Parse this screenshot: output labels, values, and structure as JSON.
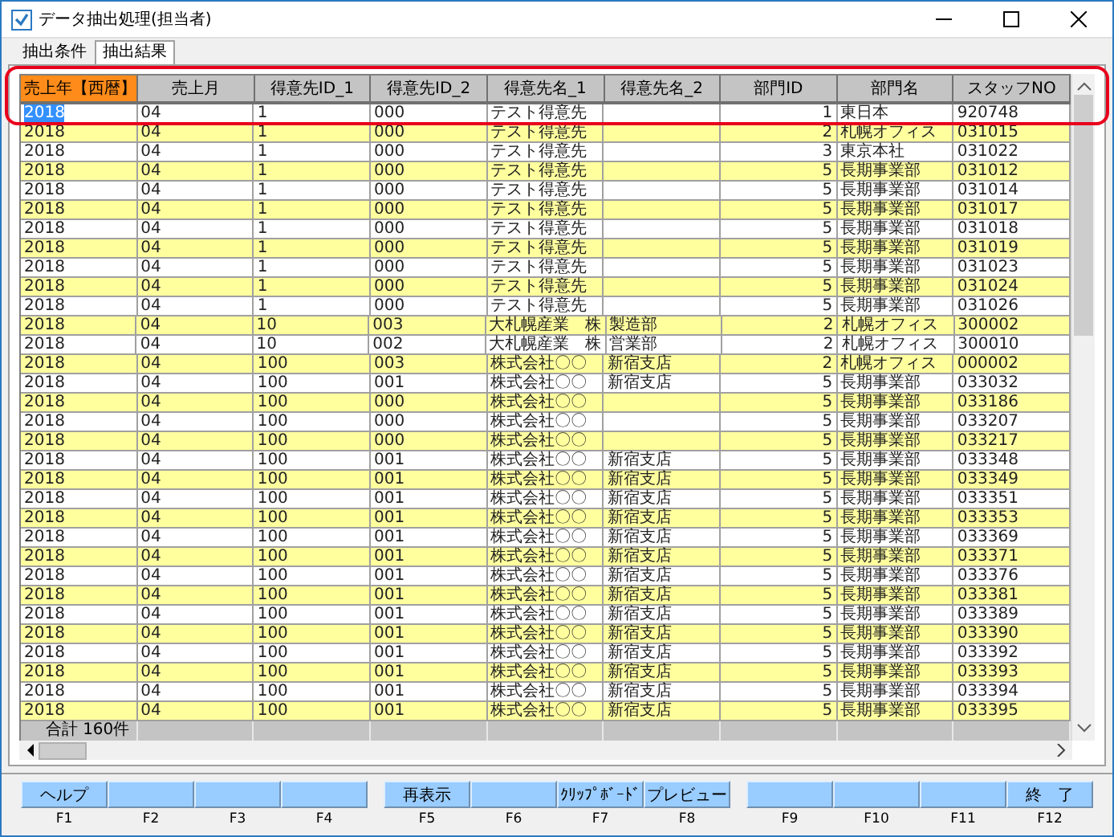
{
  "window": {
    "title": "データ抽出処理(担当者)"
  },
  "tabs": [
    {
      "label": "抽出条件",
      "selected": false
    },
    {
      "label": "抽出結果",
      "selected": true
    }
  ],
  "table": {
    "columns": [
      {
        "label": "売上年【西暦】",
        "highlighted": true
      },
      {
        "label": "売上月",
        "highlighted": false
      },
      {
        "label": "得意先ID_1",
        "highlighted": false
      },
      {
        "label": "得意先ID_2",
        "highlighted": false
      },
      {
        "label": "得意先名_1",
        "highlighted": false
      },
      {
        "label": "得意先名_2",
        "highlighted": false
      },
      {
        "label": "部門ID",
        "highlighted": false
      },
      {
        "label": "部門名",
        "highlighted": false
      },
      {
        "label": "スタッフNO",
        "highlighted": false
      }
    ],
    "rows": [
      {
        "year": "2018",
        "month": "04",
        "customer_id_1": "1",
        "customer_id_2": "000",
        "customer_name_1": "テスト得意先",
        "dept_id": "1",
        "dept_name": "東日本",
        "staff_no": "920748",
        "selected": true
      },
      {
        "year": "2018",
        "month": "04",
        "customer_id_1": "1",
        "customer_id_2": "000",
        "customer_name_1": "テスト得意先",
        "dept_id": "2",
        "dept_name": "札幌オフィス",
        "staff_no": "031015",
        "selected": false
      },
      {
        "year": "2018",
        "month": "04",
        "customer_id_1": "1",
        "customer_id_2": "000",
        "customer_name_1": "テスト得意先",
        "dept_id": "3",
        "dept_name": "東京本社",
        "staff_no": "031022",
        "selected": false
      },
      {
        "year": "2018",
        "month": "04",
        "customer_id_1": "1",
        "customer_id_2": "000",
        "customer_name_1": "テスト得意先",
        "dept_id": "5",
        "dept_name": "長期事業部",
        "staff_no": "031012",
        "selected": false
      },
      {
        "year": "2018",
        "month": "04",
        "customer_id_1": "1",
        "customer_id_2": "000",
        "customer_name_1": "テスト得意先",
        "dept_id": "5",
        "dept_name": "長期事業部",
        "staff_no": "031014",
        "selected": false
      },
      {
        "year": "2018",
        "month": "04",
        "customer_id_1": "1",
        "customer_id_2": "000",
        "customer_name_1": "テスト得意先",
        "dept_id": "5",
        "dept_name": "長期事業部",
        "staff_no": "031017",
        "selected": false
      },
      {
        "year": "2018",
        "month": "04",
        "customer_id_1": "1",
        "customer_id_2": "000",
        "customer_name_1": "テスト得意先",
        "dept_id": "5",
        "dept_name": "長期事業部",
        "staff_no": "031018",
        "selected": false
      },
      {
        "year": "2018",
        "month": "04",
        "customer_id_1": "1",
        "customer_id_2": "000",
        "customer_name_1": "テスト得意先",
        "dept_id": "5",
        "dept_name": "長期事業部",
        "staff_no": "031019",
        "selected": false
      },
      {
        "year": "2018",
        "month": "04",
        "customer_id_1": "1",
        "customer_id_2": "000",
        "customer_name_1": "テスト得意先",
        "dept_id": "5",
        "dept_name": "長期事業部",
        "staff_no": "031023",
        "selected": false
      },
      {
        "year": "2018",
        "month": "04",
        "customer_id_1": "1",
        "customer_id_2": "000",
        "customer_name_1": "テスト得意先",
        "dept_id": "5",
        "dept_name": "長期事業部",
        "staff_no": "031024",
        "selected": false
      },
      {
        "year": "2018",
        "month": "04",
        "customer_id_1": "1",
        "customer_id_2": "000",
        "customer_name_1": "テスト得意先",
        "dept_id": "5",
        "dept_name": "長期事業部",
        "staff_no": "031026",
        "selected": false
      },
      {
        "year": "2018",
        "month": "04",
        "customer_id_1": "10",
        "customer_id_2": "003",
        "customer_name_1": "大札幌産業　株",
        "customer_name_2": "製造部",
        "dept_id": "2",
        "dept_name": "札幌オフィス",
        "staff_no": "300002",
        "selected": false
      },
      {
        "year": "2018",
        "month": "04",
        "customer_id_1": "10",
        "customer_id_2": "002",
        "customer_name_1": "大札幌産業　株",
        "customer_name_2": "営業部",
        "dept_id": "2",
        "dept_name": "札幌オフィス",
        "staff_no": "300010",
        "selected": false
      },
      {
        "year": "2018",
        "month": "04",
        "customer_id_1": "100",
        "customer_id_2": "003",
        "customer_name_1": "株式会社〇〇",
        "customer_name_2": "新宿支店",
        "dept_id": "2",
        "dept_name": "札幌オフィス",
        "staff_no": "000002",
        "selected": false
      },
      {
        "year": "2018",
        "month": "04",
        "customer_id_1": "100",
        "customer_id_2": "001",
        "customer_name_1": "株式会社〇〇",
        "customer_name_2": "新宿支店",
        "dept_id": "5",
        "dept_name": "長期事業部",
        "staff_no": "033032",
        "selected": false
      },
      {
        "year": "2018",
        "month": "04",
        "customer_id_1": "100",
        "customer_id_2": "000",
        "customer_name_1": "株式会社〇〇",
        "dept_id": "5",
        "dept_name": "長期事業部",
        "staff_no": "033186",
        "selected": false
      },
      {
        "year": "2018",
        "month": "04",
        "customer_id_1": "100",
        "customer_id_2": "000",
        "customer_name_1": "株式会社〇〇",
        "dept_id": "5",
        "dept_name": "長期事業部",
        "staff_no": "033207",
        "selected": false
      },
      {
        "year": "2018",
        "month": "04",
        "customer_id_1": "100",
        "customer_id_2": "000",
        "customer_name_1": "株式会社〇〇",
        "dept_id": "5",
        "dept_name": "長期事業部",
        "staff_no": "033217",
        "selected": false
      },
      {
        "year": "2018",
        "month": "04",
        "customer_id_1": "100",
        "customer_id_2": "001",
        "customer_name_1": "株式会社〇〇",
        "customer_name_2": "新宿支店",
        "dept_id": "5",
        "dept_name": "長期事業部",
        "staff_no": "033348",
        "selected": false
      },
      {
        "year": "2018",
        "month": "04",
        "customer_id_1": "100",
        "customer_id_2": "001",
        "customer_name_1": "株式会社〇〇",
        "customer_name_2": "新宿支店",
        "dept_id": "5",
        "dept_name": "長期事業部",
        "staff_no": "033349",
        "selected": false
      },
      {
        "year": "2018",
        "month": "04",
        "customer_id_1": "100",
        "customer_id_2": "001",
        "customer_name_1": "株式会社〇〇",
        "customer_name_2": "新宿支店",
        "dept_id": "5",
        "dept_name": "長期事業部",
        "staff_no": "033351",
        "selected": false
      },
      {
        "year": "2018",
        "month": "04",
        "customer_id_1": "100",
        "customer_id_2": "001",
        "customer_name_1": "株式会社〇〇",
        "customer_name_2": "新宿支店",
        "dept_id": "5",
        "dept_name": "長期事業部",
        "staff_no": "033353",
        "selected": false
      },
      {
        "year": "2018",
        "month": "04",
        "customer_id_1": "100",
        "customer_id_2": "001",
        "customer_name_1": "株式会社〇〇",
        "customer_name_2": "新宿支店",
        "dept_id": "5",
        "dept_name": "長期事業部",
        "staff_no": "033369",
        "selected": false
      },
      {
        "year": "2018",
        "month": "04",
        "customer_id_1": "100",
        "customer_id_2": "001",
        "customer_name_1": "株式会社〇〇",
        "customer_name_2": "新宿支店",
        "dept_id": "5",
        "dept_name": "長期事業部",
        "staff_no": "033371",
        "selected": false
      },
      {
        "year": "2018",
        "month": "04",
        "customer_id_1": "100",
        "customer_id_2": "001",
        "customer_name_1": "株式会社〇〇",
        "customer_name_2": "新宿支店",
        "dept_id": "5",
        "dept_name": "長期事業部",
        "staff_no": "033376",
        "selected": false
      },
      {
        "year": "2018",
        "month": "04",
        "customer_id_1": "100",
        "customer_id_2": "001",
        "customer_name_1": "株式会社〇〇",
        "customer_name_2": "新宿支店",
        "dept_id": "5",
        "dept_name": "長期事業部",
        "staff_no": "033381",
        "selected": false
      },
      {
        "year": "2018",
        "month": "04",
        "customer_id_1": "100",
        "customer_id_2": "001",
        "customer_name_1": "株式会社〇〇",
        "customer_name_2": "新宿支店",
        "dept_id": "5",
        "dept_name": "長期事業部",
        "staff_no": "033389",
        "selected": false
      },
      {
        "year": "2018",
        "month": "04",
        "customer_id_1": "100",
        "customer_id_2": "001",
        "customer_name_1": "株式会社〇〇",
        "customer_name_2": "新宿支店",
        "dept_id": "5",
        "dept_name": "長期事業部",
        "staff_no": "033390",
        "selected": false
      },
      {
        "year": "2018",
        "month": "04",
        "customer_id_1": "100",
        "customer_id_2": "001",
        "customer_name_1": "株式会社〇〇",
        "customer_name_2": "新宿支店",
        "dept_id": "5",
        "dept_name": "長期事業部",
        "staff_no": "033392",
        "selected": false
      },
      {
        "year": "2018",
        "month": "04",
        "customer_id_1": "100",
        "customer_id_2": "001",
        "customer_name_1": "株式会社〇〇",
        "customer_name_2": "新宿支店",
        "dept_id": "5",
        "dept_name": "長期事業部",
        "staff_no": "033393",
        "selected": false
      },
      {
        "year": "2018",
        "month": "04",
        "customer_id_1": "100",
        "customer_id_2": "001",
        "customer_name_1": "株式会社〇〇",
        "customer_name_2": "新宿支店",
        "dept_id": "5",
        "dept_name": "長期事業部",
        "staff_no": "033394",
        "selected": false
      },
      {
        "year": "2018",
        "month": "04",
        "customer_id_1": "100",
        "customer_id_2": "001",
        "customer_name_1": "株式会社〇〇",
        "customer_name_2": "新宿支店",
        "dept_id": "5",
        "dept_name": "長期事業部",
        "staff_no": "033395",
        "selected": false
      }
    ],
    "total": "合計 160件"
  },
  "function_keys": [
    {
      "label": "ヘルプ",
      "key": "F1"
    },
    {
      "key": "F2"
    },
    {
      "key": "F3"
    },
    {
      "key": "F4"
    },
    {
      "label": "再表示",
      "key": "F5"
    },
    {
      "key": "F6"
    },
    {
      "label": "ｸﾘｯﾌﾟﾎﾞｰﾄﾞ",
      "key": "F7"
    },
    {
      "label": "プレビュー",
      "key": "F8"
    },
    {
      "key": "F9"
    },
    {
      "key": "F10"
    },
    {
      "key": "F11"
    },
    {
      "label": "終　了",
      "key": "F12"
    }
  ]
}
